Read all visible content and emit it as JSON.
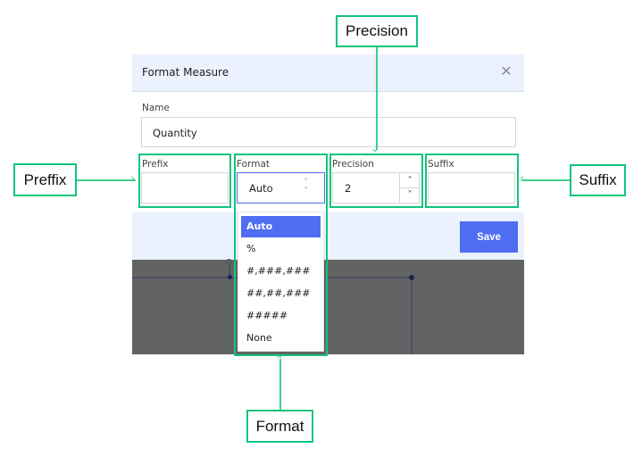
{
  "dialog": {
    "title": "Format Measure",
    "close_icon": "close-icon",
    "name_label": "Name",
    "name_value": "Quantity",
    "prefix_label": "Prefix",
    "prefix_value": "",
    "format_label": "Format",
    "format_value": "Auto",
    "precision_label": "Precision",
    "precision_value": "2",
    "suffix_label": "Suffix",
    "suffix_value": "",
    "save_label": "Save"
  },
  "format_options": [
    "Auto",
    "%",
    "#,###,###",
    "##,##,###",
    "#####",
    "None"
  ],
  "selected_format_index": 0,
  "annotations": {
    "precision": "Precision",
    "prefix": "Preffix",
    "suffix": "Suffix",
    "format": "Format"
  },
  "colors": {
    "accent": "#4f6ef2",
    "annotation": "#12c47c",
    "header_bg": "#ebf1fd"
  }
}
